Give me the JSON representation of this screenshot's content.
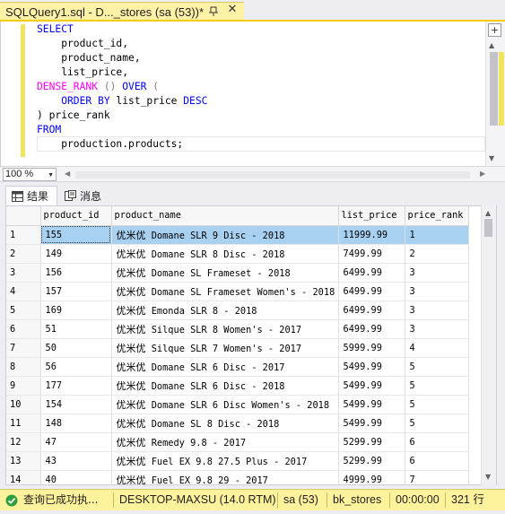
{
  "window": {
    "tab_title": "SQLQuery1.sql - D..._stores (sa (53))*",
    "close_glyph": "✕"
  },
  "editor": {
    "lines": [
      {
        "kw": "SELECT"
      },
      {
        "text": "    product_id,"
      },
      {
        "text": "    product_name,"
      },
      {
        "text": "    list_price,"
      },
      {
        "fn": "DENSE_RANK",
        "rest_gray": " () ",
        "kw2": "OVER",
        "rest2": " ("
      },
      {
        "kw": "    ORDER BY",
        "text": " list_price ",
        "kw2": "DESC"
      },
      {
        "text": ") price_rank"
      },
      {
        "kw": "FROM"
      },
      {
        "text": "    production.products;"
      }
    ],
    "split_glyph": "+"
  },
  "zoom": {
    "value": "100 %"
  },
  "result_tabs": {
    "results_label": "结果",
    "messages_label": "消息"
  },
  "grid": {
    "columns": [
      "product_id",
      "product_name",
      "list_price",
      "price_rank"
    ],
    "rows": [
      {
        "n": "1",
        "id": "155",
        "cn": "优米优",
        "name": " Domane SLR 9 Disc - 2018",
        "price": "11999.99",
        "rank": "1"
      },
      {
        "n": "2",
        "id": "149",
        "cn": "优米优",
        "name": " Domane SLR 8 Disc - 2018",
        "price": "7499.99",
        "rank": "2"
      },
      {
        "n": "3",
        "id": "156",
        "cn": "优米优",
        "name": " Domane SL Frameset - 2018",
        "price": "6499.99",
        "rank": "3"
      },
      {
        "n": "4",
        "id": "157",
        "cn": "优米优",
        "name": " Domane SL Frameset Women's - 2018",
        "price": "6499.99",
        "rank": "3"
      },
      {
        "n": "5",
        "id": "169",
        "cn": "优米优",
        "name": " Emonda SLR 8 - 2018",
        "price": "6499.99",
        "rank": "3"
      },
      {
        "n": "6",
        "id": "51",
        "cn": "优米优",
        "name": " Silque SLR 8 Women's - 2017",
        "price": "6499.99",
        "rank": "3"
      },
      {
        "n": "7",
        "id": "50",
        "cn": "优米优",
        "name": " Silque SLR 7 Women's - 2017",
        "price": "5999.99",
        "rank": "4"
      },
      {
        "n": "8",
        "id": "56",
        "cn": "优米优",
        "name": " Domane SLR 6 Disc - 2017",
        "price": "5499.99",
        "rank": "5"
      },
      {
        "n": "9",
        "id": "177",
        "cn": "优米优",
        "name": " Domane SLR 6 Disc - 2018",
        "price": "5499.99",
        "rank": "5"
      },
      {
        "n": "10",
        "id": "154",
        "cn": "优米优",
        "name": " Domane SLR 6 Disc Women's - 2018",
        "price": "5499.99",
        "rank": "5"
      },
      {
        "n": "11",
        "id": "148",
        "cn": "优米优",
        "name": " Domane SL 8 Disc - 2018",
        "price": "5499.99",
        "rank": "5"
      },
      {
        "n": "12",
        "id": "47",
        "cn": "优米优",
        "name": " Remedy 9.8 - 2017",
        "price": "5299.99",
        "rank": "6"
      },
      {
        "n": "13",
        "id": "43",
        "cn": "优米优",
        "name": " Fuel EX 9.8 27.5 Plus - 2017",
        "price": "5299.99",
        "rank": "6"
      },
      {
        "n": "14",
        "id": "40",
        "cn": "优米优",
        "name": " Fuel EX 9.8 29 - 2017",
        "price": "4999.99",
        "rank": "7"
      }
    ],
    "selected_row": 0
  },
  "status": {
    "message": "查询已成功执...",
    "server": "DESKTOP-MAXSU (14.0 RTM)",
    "user": "sa (53)",
    "database": "bk_stores",
    "elapsed": "00:00:00",
    "rows": "321 行"
  },
  "colors": {
    "accent_yellow": "#f5cc00",
    "status_bar": "#fff29d",
    "selection": "#a8d0f0",
    "keyword": "#0000ff",
    "function": "#ff00ff"
  },
  "icons": [
    "pin-icon",
    "close-icon",
    "results-grid-icon",
    "messages-icon",
    "success-check-icon"
  ]
}
